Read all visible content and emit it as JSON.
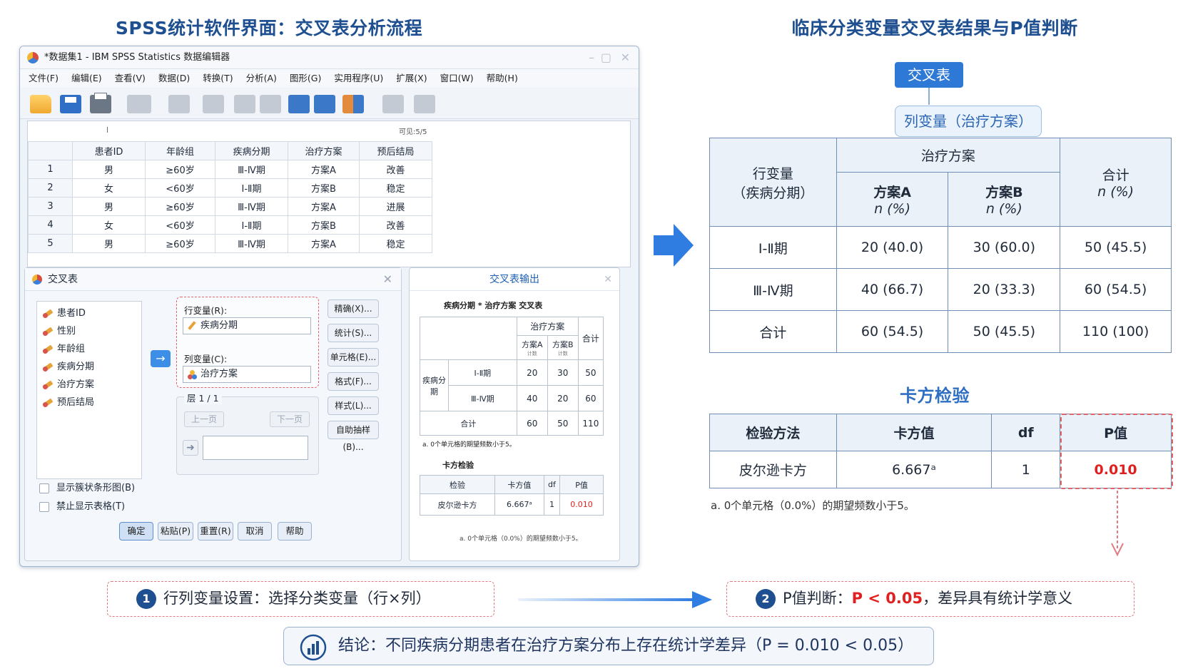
{
  "left_heading": "SPSS统计软件界面：交叉表分析流程",
  "right_heading": "临床分类变量交叉表结果与P值判断",
  "spss": {
    "window_title": "*数据集1 - IBM SPSS Statistics 数据编辑器",
    "menu": [
      "文件(F)",
      "编辑(E)",
      "查看(V)",
      "数据(D)",
      "转换(T)",
      "分析(A)",
      "图形(G)",
      "实用程序(U)",
      "扩展(X)",
      "窗口(W)",
      "帮助(H)"
    ],
    "grid": {
      "cell_ref": "l",
      "visible_label": "可见:5/5",
      "columns": [
        "患者ID",
        "年龄组",
        "疾病分期",
        "治疗方案",
        "预后结局"
      ],
      "rows": [
        {
          "n": "1",
          "cells": [
            "男",
            "≥60岁",
            "Ⅲ-Ⅳ期",
            "方案A",
            "改善"
          ]
        },
        {
          "n": "2",
          "cells": [
            "女",
            "<60岁",
            "Ⅰ-Ⅱ期",
            "方案B",
            "稳定"
          ]
        },
        {
          "n": "3",
          "cells": [
            "男",
            "≥60岁",
            "Ⅲ-Ⅳ期",
            "方案A",
            "进展"
          ]
        },
        {
          "n": "4",
          "cells": [
            "女",
            "<60岁",
            "Ⅰ-Ⅱ期",
            "方案B",
            "改善"
          ]
        },
        {
          "n": "5",
          "cells": [
            "男",
            "≥60岁",
            "Ⅲ-Ⅳ期",
            "方案A",
            "稳定"
          ]
        }
      ]
    },
    "dialog": {
      "title": "交叉表",
      "variables": [
        "患者ID",
        "性别",
        "年龄组",
        "疾病分期",
        "治疗方案",
        "预后结局"
      ],
      "move_arrow": "→",
      "row_label": "行变量(R):",
      "row_value": "疾病分期",
      "col_label": "列变量(C):",
      "col_value": "治疗方案",
      "layer_label": "层 1 / 1",
      "prev": "上一页",
      "next": "下一页",
      "side_buttons": [
        "精确(X)...",
        "统计(S)...",
        "单元格(E)...",
        "格式(F)...",
        "样式(L)...",
        "自助抽样(B)..."
      ],
      "checkbox1": "显示簇状条形图(B)",
      "checkbox2": "禁止显示表格(T)",
      "bottom_buttons": [
        "确定",
        "粘贴(P)",
        "重置(R)",
        "取消",
        "帮助"
      ]
    },
    "output": {
      "title": "交叉表输出",
      "table_title": "疾病分期 * 治疗方案 交叉表",
      "col_group": "治疗方案",
      "col_a": "方案A",
      "col_b": "方案B",
      "col_total": "合计",
      "sub_mark": "计数",
      "row_group": "疾病分期",
      "rows": [
        {
          "label": "Ⅰ-Ⅱ期",
          "a": "20",
          "b": "30",
          "t": "50"
        },
        {
          "label": "Ⅲ-Ⅳ期",
          "a": "40",
          "b": "20",
          "t": "60"
        }
      ],
      "total_row": {
        "label": "合计",
        "a": "60",
        "b": "50",
        "t": "110"
      },
      "note_a": "a. 0个单元格的期望频数小于5。",
      "chi_title": "卡方检验",
      "chi_headers": [
        "检验",
        "卡方值",
        "df",
        "P值"
      ],
      "chi_row": {
        "method": "皮尔逊卡方",
        "value": "6.667ᵃ",
        "df": "1",
        "p": "0.010"
      },
      "chi_note": "a. 0个单元格（0.0%）的期望频数小于5。"
    }
  },
  "right": {
    "crosstab_pill": "交叉表",
    "col_var_pill": "列变量（治疗方案）",
    "table": {
      "row_var_line1": "行变量",
      "row_var_line2": "（疾病分期）",
      "group": "治疗方案",
      "col_a": "方案A",
      "col_b": "方案B",
      "col_total": "合计",
      "unit": "n (%)",
      "rows": [
        {
          "label": "Ⅰ-Ⅱ期",
          "a": "20 (40.0)",
          "b": "30 (60.0)",
          "t": "50 (45.5)"
        },
        {
          "label": "Ⅲ-Ⅳ期",
          "a": "40 (66.7)",
          "b": "20 (33.3)",
          "t": "60 (54.5)"
        },
        {
          "label": "合计",
          "a": "60 (54.5)",
          "b": "50 (45.5)",
          "t": "110 (100)"
        }
      ]
    },
    "chi_heading": "卡方检验",
    "chi": {
      "headers": [
        "检验方法",
        "卡方值",
        "df",
        "P值"
      ],
      "method": "皮尔逊卡方",
      "value": "6.667ᵃ",
      "df": "1",
      "p": "0.010"
    },
    "chi_note": "a. 0个单元格（0.0%）的期望频数小于5。"
  },
  "callout1": {
    "num": "1",
    "text": "行列变量设置：选择分类变量（行×列）"
  },
  "callout2": {
    "num": "2",
    "prefix": "P值判断：",
    "highlight": "P < 0.05",
    "suffix": "，差异具有统计学意义"
  },
  "conclusion": "结论：不同疾病分期患者在治疗方案分布上存在统计学差异（P = 0.010 < 0.05）",
  "colors": {
    "accent": "#1d4f91",
    "highlight": "#e02020",
    "arrow": "#2f7de1"
  }
}
